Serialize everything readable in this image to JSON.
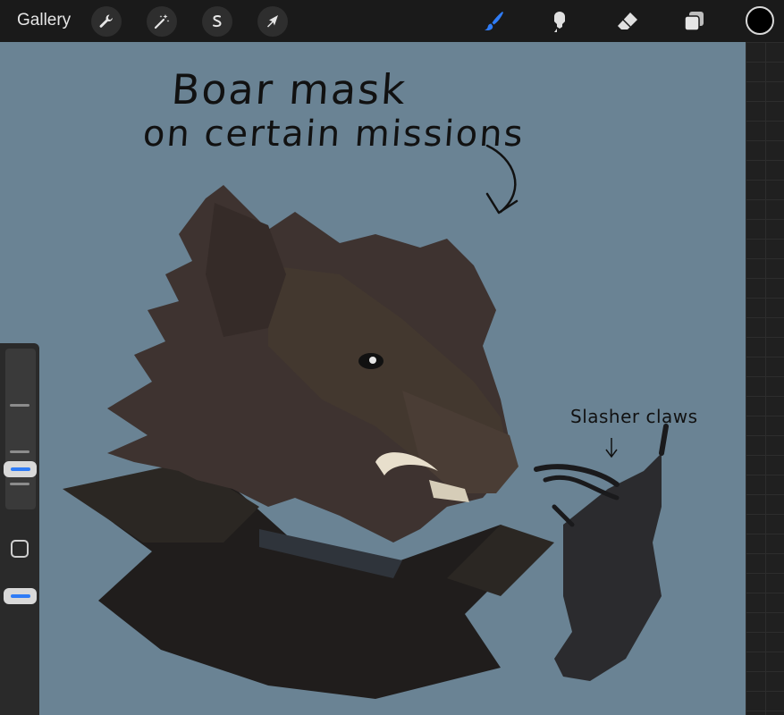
{
  "toolbar": {
    "gallery_label": "Gallery",
    "left_tools": [
      "wrench-icon",
      "magic-wand-icon",
      "selection-icon",
      "transform-arrow-icon"
    ],
    "right_tools": [
      "brush-icon",
      "smudge-icon",
      "eraser-icon",
      "layers-icon"
    ],
    "active_tool": "brush",
    "accent_color": "#2f7cf6",
    "current_color": "#000000"
  },
  "canvas": {
    "background_color": "#6a8394",
    "caption_line1": "Boar mask",
    "caption_line2": "on certain missions",
    "caption_claws": "Slasher claws"
  },
  "sidebar": {
    "brush_size_level": 0.35,
    "opacity_level": 0.5
  }
}
